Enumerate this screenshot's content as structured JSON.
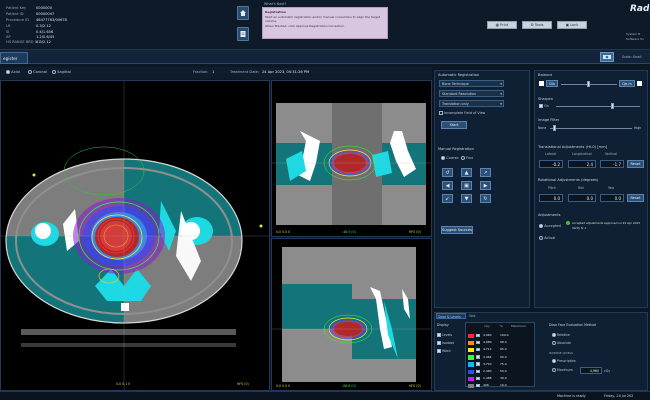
{
  "header": {
    "patient_info": [
      {
        "label": "Patient Key",
        "value": "0000000"
      },
      {
        "label": "Patient ID",
        "value": "00000047"
      },
      {
        "label": "Procedure ID",
        "value": "46477763/00678"
      },
      {
        "label": "LR",
        "value": "0.3/2.12"
      },
      {
        "label": "SI",
        "value": "0.4/1.656"
      },
      {
        "label": "AP",
        "value": "1.2/0.6/45"
      },
      {
        "label": "HS RANGE BRD 1:1",
        "value": "0.3/2.12"
      }
    ],
    "whats_next_label": "What's Next?",
    "message": {
      "title": "Registration",
      "lines": [
        "Start an automatic registration and/or manual corrections to align the target volume.",
        "When finished, click Approve Registration Correction."
      ]
    },
    "toolbar_buttons": [
      "Print",
      "Tools",
      "Lock"
    ],
    "brand": "Rad",
    "system_lines": [
      "System R",
      "Software Sv"
    ],
    "kv_label": "Scale: Small"
  },
  "tab": {
    "label": "egister"
  },
  "viewer": {
    "orientations": [
      {
        "label": "Axial",
        "selected": true
      },
      {
        "label": "Coronal",
        "selected": false
      },
      {
        "label": "Sagittal",
        "selected": false
      }
    ],
    "fraction_label": "Fraction:",
    "fraction_value": "1",
    "treatment_date_label": "Treatment Date:",
    "treatment_date": "24 Apr 2023, 04:31:26 PM",
    "main_corners": {
      "bottom_left": "0.0 0.1 0",
      "bottom_right": "HFS (0)"
    },
    "top_view_corners": {
      "bottom_left": "0.0 0.0 0",
      "bottom_center": "-46.5 (0)",
      "bottom_right": "HFS (0)"
    },
    "bottom_view_corners": {
      "bottom_left": "0.0 0.0 0",
      "bottom_center": "-06.8 (0)",
      "bottom_right": "HFS (0)"
    }
  },
  "auto_registration": {
    "title": "Automatic Registration",
    "dropdowns": [
      "Bone Technique",
      "Standard Resolution",
      "Translation only"
    ],
    "checkbox": "Incomplete Field of View",
    "start_button": "Start"
  },
  "manual_registration": {
    "title": "Manual Registration",
    "options": [
      {
        "label": "Coarse",
        "selected": true
      },
      {
        "label": "Fine",
        "selected": false
      }
    ],
    "arrows": [
      "↺",
      "▲",
      "↗",
      "◀",
      "▣",
      "▶",
      "↙",
      "▼",
      "↻"
    ],
    "suggest_button": "Suggest Sources"
  },
  "blending": {
    "title": "Balance",
    "left": "Dis",
    "right": "Qe.m",
    "sharpen_title": "Sharpen",
    "sharpen_check": "On",
    "filter_title": "Image Filter",
    "filter_left": "None",
    "filter_right": "High"
  },
  "translational": {
    "title": "Translational Adjustments (Ht-0) [mm]",
    "headers": [
      "Lateral",
      "Longitudinal",
      "Vertical"
    ],
    "values": [
      "-0.2",
      "2.4",
      "-1.7"
    ],
    "reset": "Reset"
  },
  "rotational": {
    "title": "Rotational Adjustments (degrees)",
    "headers": [
      "Pitch",
      "Roll",
      "Yaw"
    ],
    "values": [
      "0.0",
      "0.0",
      "0.0"
    ],
    "reset": "Reset"
  },
  "adjustments": {
    "title": "Adjustments",
    "accepted_label": "Accepted",
    "accepted_note": "Accepted adjustments approved on 24 Apr 2023",
    "accepted_sub": "Verify fx 1",
    "actual_label": "Actual"
  },
  "dose_panel": {
    "tabs": [
      "Dose & Levels",
      "Vols"
    ],
    "display_title": "Display",
    "display_items": [
      {
        "label": "Levels",
        "checked": true
      },
      {
        "label": "Isodose",
        "checked": true
      },
      {
        "label": "Wash",
        "checked": true
      }
    ],
    "table_headers": [
      "",
      "cGy",
      "%",
      "Maximum"
    ],
    "rows": [
      {
        "color": "#ff2a2a",
        "cgy": "4,960",
        "pct": "100.0"
      },
      {
        "color": "#ff8c1a",
        "cgy": "4,880",
        "pct": "98.4"
      },
      {
        "color": "#ffe81a",
        "cgy": "4,712",
        "pct": "95.0"
      },
      {
        "color": "#33ff33",
        "cgy": "4,464",
        "pct": "90.0"
      },
      {
        "color": "#1ab1ff",
        "cgy": "3,720",
        "pct": "75.0"
      },
      {
        "color": "#2a4dff",
        "cgy": "2,480",
        "pct": "50.0"
      },
      {
        "color": "#c41aff",
        "cgy": "1,488",
        "pct": "30.0"
      },
      {
        "color": "#7f7f7f",
        "cgy": "496",
        "pct": "10.0"
      }
    ],
    "eval_title": "Dose Face Evaluation Method",
    "eval_options": [
      {
        "label": "Relative",
        "selected": true
      },
      {
        "label": "Absolute",
        "selected": false
      }
    ],
    "isodose_title": "ISODOSE LEVELS",
    "isodose_options": [
      {
        "label": "Prescription",
        "selected": true
      },
      {
        "label": "Maximum",
        "selected": false
      }
    ],
    "maximum_value": "4,960",
    "maximum_unit": "cGy"
  },
  "status": {
    "ready": "Machine is ready",
    "datetime": "Friday, 24 Jul 202"
  },
  "colors": {
    "accent": "#2c4f76",
    "panel": "#102034",
    "ring": "#ff3030",
    "cyan": "#22d8e6",
    "teal": "#0f6e72"
  }
}
